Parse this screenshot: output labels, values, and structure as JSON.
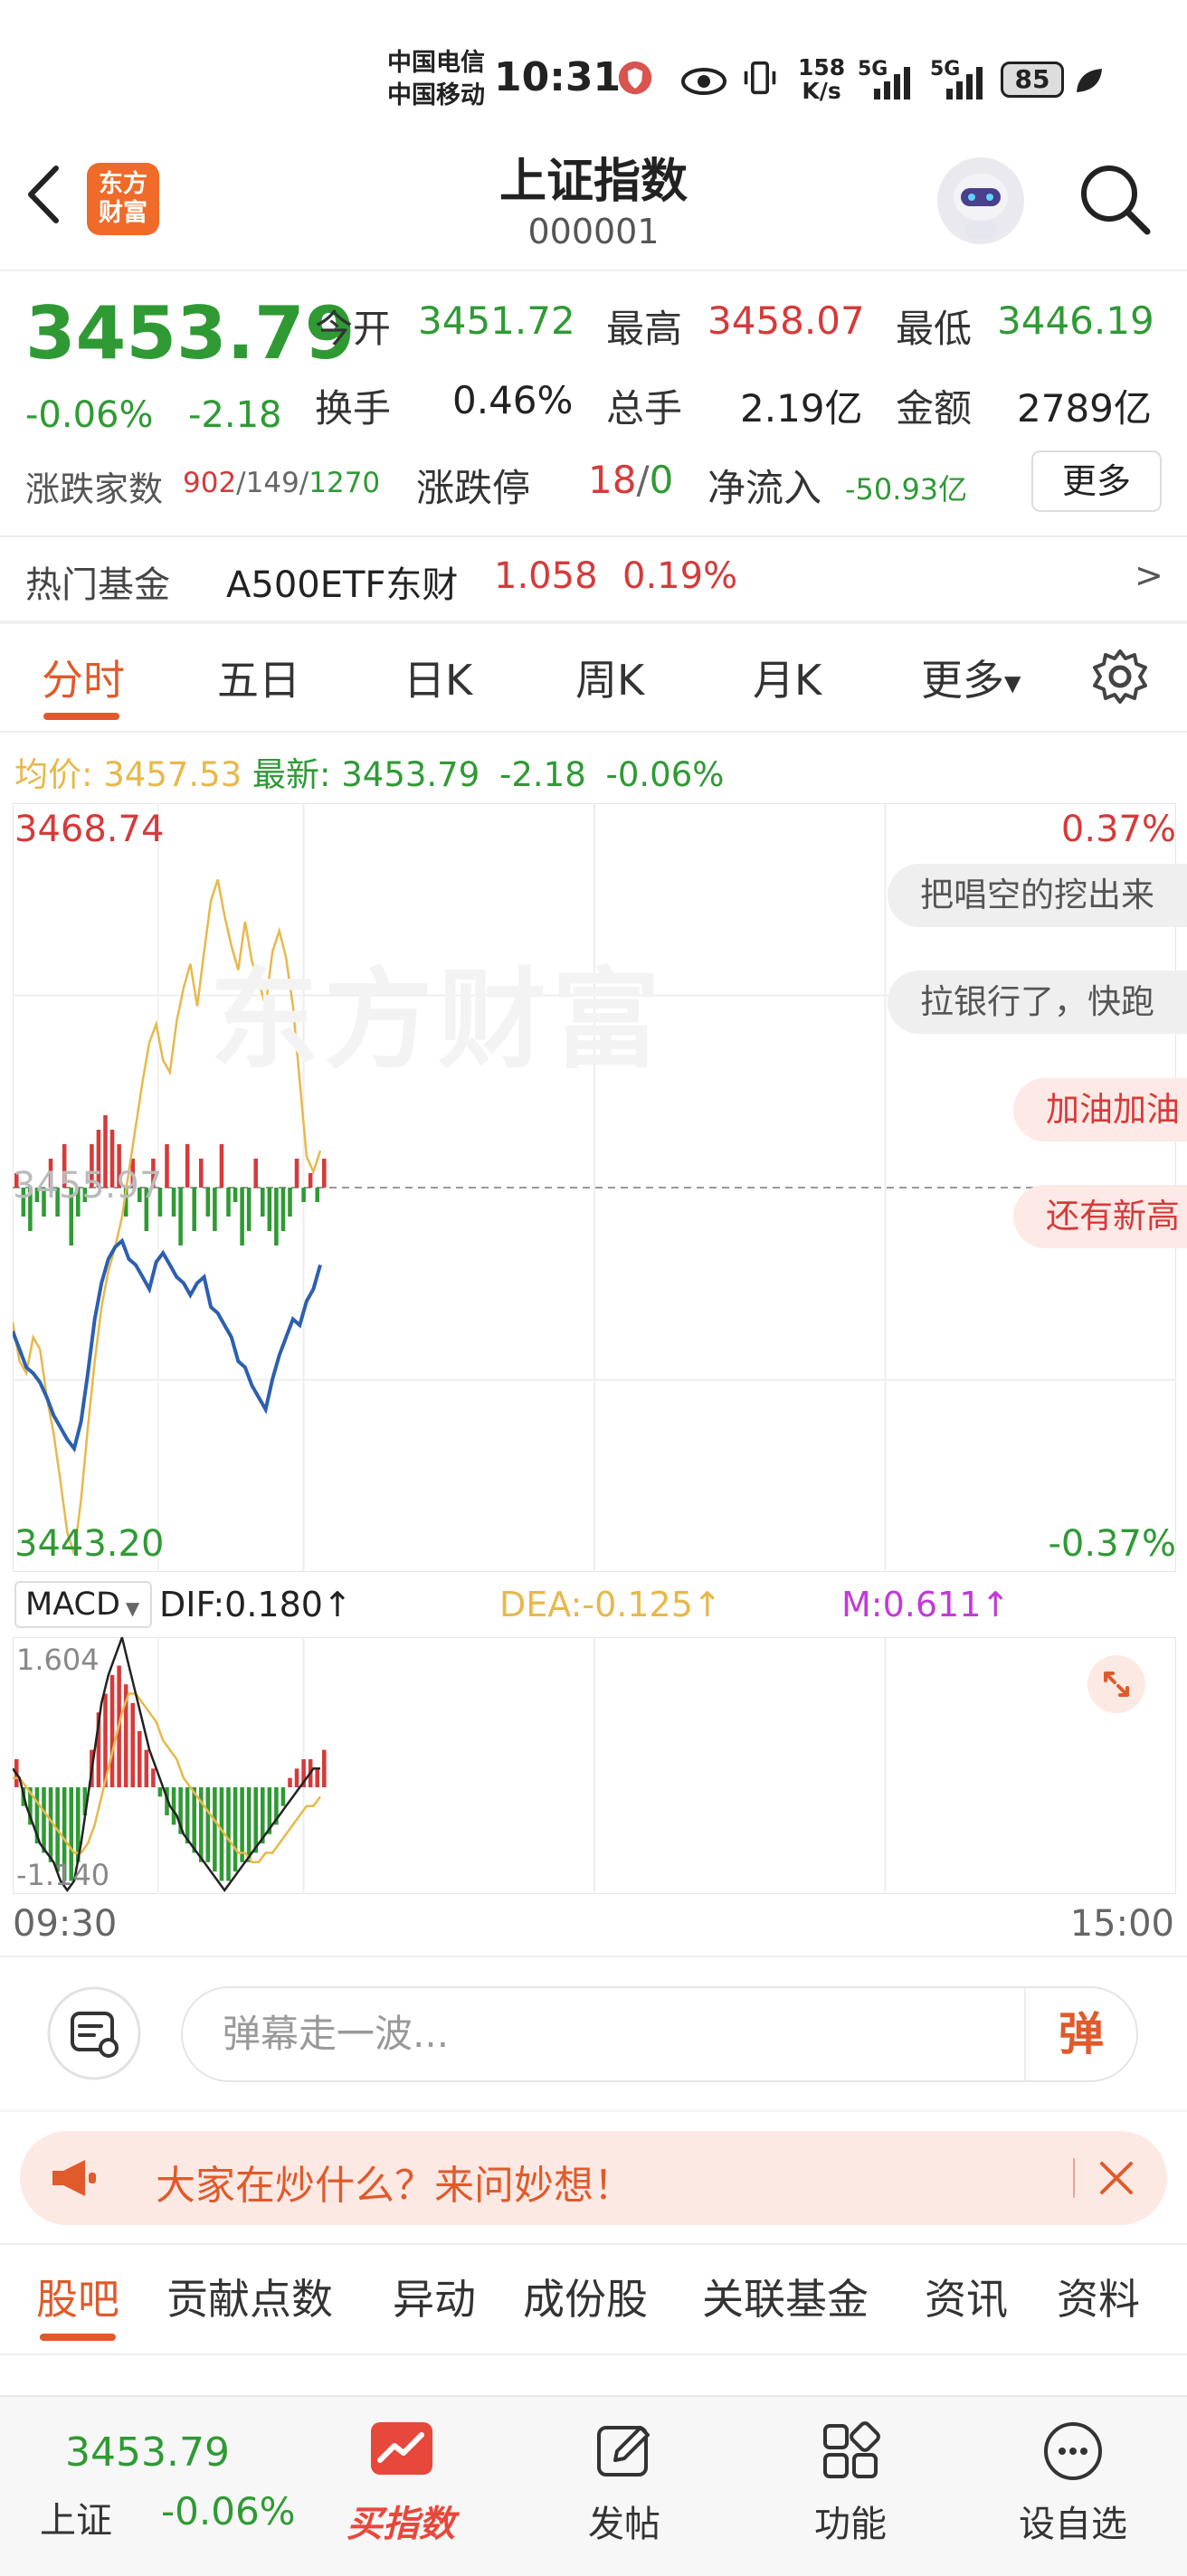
{
  "status_bar": {
    "carrier1": "中国电信",
    "carrier2": "中国移动",
    "time": "10:31",
    "net_speed_value": "158",
    "net_speed_unit": "K/s",
    "signal1": "5G",
    "signal2": "5G",
    "battery": "85"
  },
  "header": {
    "logo_line1": "东方",
    "logo_line2": "财富",
    "title": "上证指数",
    "code": "000001"
  },
  "quote": {
    "price": "3453.79",
    "change_pct": "-0.06%",
    "change": "-2.18",
    "open_label": "今开",
    "open": "3451.72",
    "high_label": "最高",
    "high": "3458.07",
    "low_label": "最低",
    "low": "3446.19",
    "turnover_label": "换手",
    "turnover": "0.46%",
    "volume_label": "总手",
    "volume": "2.19亿",
    "amount_label": "金额",
    "amount": "2789亿",
    "breadth_label": "涨跌家数",
    "up_count": "902",
    "flat_count": "149",
    "down_count": "1270",
    "limit_label": "涨跌停",
    "limit_up": "18",
    "limit_down": "0",
    "netflow_label": "净流入",
    "netflow": "-50.93亿",
    "more_label": "更多"
  },
  "hot_fund": {
    "label": "热门基金",
    "name": "A500ETF东财",
    "price": "1.058",
    "change": "0.19%",
    "arrow": ">"
  },
  "tabs": [
    "分时",
    "五日",
    "日K",
    "周K",
    "月K",
    "更多"
  ],
  "avg_line": {
    "avg_label": "均价:",
    "avg_value": "3457.53",
    "latest_label": "最新:",
    "latest_value": "3453.79",
    "latest_change": "-2.18",
    "latest_pct": "-0.06%"
  },
  "chart_data": {
    "type": "line",
    "y_top": "3468.74",
    "y_bottom": "3443.20",
    "y_mid": "3455.97",
    "pct_top": "0.37%",
    "pct_bottom": "-0.37%",
    "watermark": "东方财富",
    "x_start": "09:30",
    "x_end": "15:00",
    "ylim": [
      3443.2,
      3468.74
    ],
    "prev_close": 3455.97,
    "price": [
      3451.5,
      3450.2,
      3449.8,
      3451.0,
      3450.6,
      3449.0,
      3447.8,
      3446.2,
      3444.5,
      3443.8,
      3445.6,
      3448.0,
      3450.2,
      3452.0,
      3453.2,
      3454.0,
      3455.0,
      3456.5,
      3458.0,
      3459.5,
      3460.8,
      3461.4,
      3460.2,
      3459.8,
      3461.5,
      3462.6,
      3463.4,
      3462.0,
      3463.8,
      3465.5,
      3466.2,
      3465.0,
      3464.0,
      3463.2,
      3464.8,
      3463.5,
      3462.8,
      3462.0,
      3463.8,
      3464.5,
      3463.6,
      3462.0,
      3459.5,
      3457.0,
      3456.5,
      3457.2
    ],
    "avg": [
      3451.2,
      3450.6,
      3450.0,
      3449.8,
      3449.5,
      3449.0,
      3448.4,
      3448.0,
      3447.6,
      3447.3,
      3448.2,
      3449.8,
      3451.6,
      3452.8,
      3453.6,
      3454.0,
      3454.2,
      3453.6,
      3453.4,
      3453.0,
      3452.6,
      3453.5,
      3453.8,
      3453.4,
      3453.0,
      3452.8,
      3452.4,
      3452.8,
      3453.0,
      3452.0,
      3451.8,
      3451.4,
      3451.0,
      3450.2,
      3450.0,
      3449.4,
      3449.0,
      3448.6,
      3449.6,
      3450.4,
      3451.0,
      3451.6,
      3451.4,
      3452.2,
      3452.6,
      3453.4
    ],
    "volume_bars": [
      1,
      -2,
      -3,
      -1,
      -2,
      2,
      -2,
      3,
      -4,
      -2,
      -1,
      3,
      4,
      5,
      4,
      3,
      -2,
      2,
      -1,
      -3,
      2,
      -2,
      3,
      -2,
      -4,
      3,
      -3,
      2,
      -2,
      -3,
      3,
      -2,
      -1,
      -4,
      -3,
      2,
      -2,
      -3,
      -4,
      -3,
      -2,
      2,
      -1,
      1,
      -1,
      2
    ],
    "macd": {
      "selector": "MACD",
      "dif": "DIF:0.180↑",
      "dea": "DEA:-0.125↑",
      "m": "M:0.611↑",
      "ymax": "1.604",
      "ymin": "-1.140",
      "ylim": [
        -1.14,
        1.604
      ],
      "hist": [
        0.3,
        -0.2,
        -0.4,
        -0.6,
        -0.7,
        -0.8,
        -0.9,
        -1.0,
        -1.0,
        -0.8,
        -0.3,
        0.4,
        0.8,
        1.0,
        1.2,
        1.3,
        1.1,
        0.9,
        0.6,
        0.4,
        0.2,
        -0.1,
        -0.3,
        -0.4,
        -0.5,
        -0.6,
        -0.7,
        -0.8,
        -0.8,
        -0.9,
        -1.0,
        -1.0,
        -0.9,
        -0.8,
        -0.8,
        -0.7,
        -0.6,
        -0.5,
        -0.4,
        -0.2,
        0.1,
        0.2,
        0.3,
        0.3,
        0.2,
        0.4
      ],
      "dif_line": [
        0.2,
        0.1,
        -0.2,
        -0.4,
        -0.6,
        -0.7,
        -0.8,
        -1.0,
        -1.1,
        -1.0,
        -0.6,
        -0.1,
        0.4,
        0.9,
        1.2,
        1.4,
        1.6,
        1.3,
        1.0,
        0.7,
        0.4,
        0.2,
        0.0,
        -0.2,
        -0.3,
        -0.5,
        -0.6,
        -0.7,
        -0.8,
        -0.9,
        -1.0,
        -1.1,
        -1.0,
        -0.9,
        -0.8,
        -0.7,
        -0.6,
        -0.5,
        -0.4,
        -0.3,
        -0.2,
        -0.1,
        0.0,
        0.1,
        0.2,
        0.2
      ],
      "dea_line": [
        0.1,
        0.1,
        0.0,
        -0.1,
        -0.2,
        -0.3,
        -0.4,
        -0.5,
        -0.6,
        -0.7,
        -0.7,
        -0.6,
        -0.4,
        -0.1,
        0.2,
        0.5,
        0.8,
        1.0,
        1.0,
        0.9,
        0.8,
        0.7,
        0.5,
        0.4,
        0.3,
        0.1,
        0.0,
        -0.1,
        -0.2,
        -0.3,
        -0.4,
        -0.5,
        -0.6,
        -0.7,
        -0.7,
        -0.8,
        -0.8,
        -0.7,
        -0.7,
        -0.6,
        -0.5,
        -0.4,
        -0.3,
        -0.2,
        -0.2,
        -0.1
      ]
    }
  },
  "comments": [
    "把唱空的挖出来",
    "拉银行了，快跑",
    "加油加油",
    "还有新高"
  ],
  "input": {
    "placeholder": "弹幕走一波...",
    "send": "弹"
  },
  "banner": {
    "text": "大家在炒什么？来问妙想！"
  },
  "bottom_tabs": [
    "股吧",
    "贡献点数",
    "异动",
    "成份股",
    "关联基金",
    "资讯",
    "资料"
  ],
  "bottom_nav": {
    "index_price": "3453.79",
    "index_name": "上证",
    "index_pct": "-0.06%",
    "buy": "买指数",
    "post": "发帖",
    "function": "功能",
    "watchlist": "设自选"
  },
  "colors": {
    "up": "#d63a3a",
    "down": "#2f9a34",
    "accent": "#e05a2b",
    "avg": "#e8b84a",
    "price_line": "#2c5fb0"
  }
}
